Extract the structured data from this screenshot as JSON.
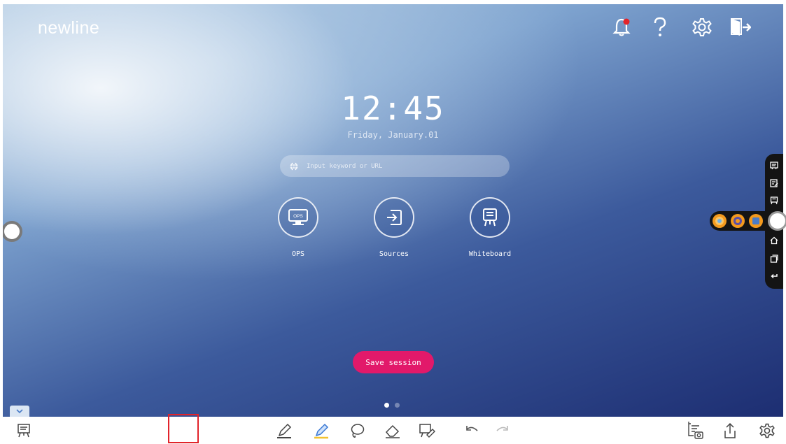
{
  "brand": "newline",
  "clock": {
    "time": "12:45",
    "date": "Friday, January.01"
  },
  "search": {
    "placeholder": "Input keyword or URL"
  },
  "apps": [
    {
      "label": "OPS",
      "icon": "ops-monitor-icon",
      "badge": "OPS"
    },
    {
      "label": "Sources",
      "icon": "input-source-icon"
    },
    {
      "label": "Whiteboard",
      "icon": "whiteboard-easel-icon"
    }
  ],
  "save_session_label": "Save session",
  "top_icons": [
    "notification-bell-icon",
    "help-icon",
    "settings-gear-icon",
    "exit-door-icon"
  ],
  "notification_dot_color": "#e2242b",
  "accent_color": "#e2196a",
  "pagination": {
    "count": 2,
    "active": 1
  },
  "sidebar_icons": [
    "whiteboard-stack-icon",
    "annotation-icon",
    "easel-icon",
    "home-icon",
    "window-icon",
    "back-icon"
  ],
  "bottom_toolbar": [
    "whiteboard-icon",
    "pencil-icon",
    "highlighter-icon",
    "lasso-icon",
    "eraser-icon",
    "screen-annotate-icon",
    "undo-icon",
    "redo-icon",
    "screenshot-icon",
    "share-icon",
    "settings-icon"
  ]
}
